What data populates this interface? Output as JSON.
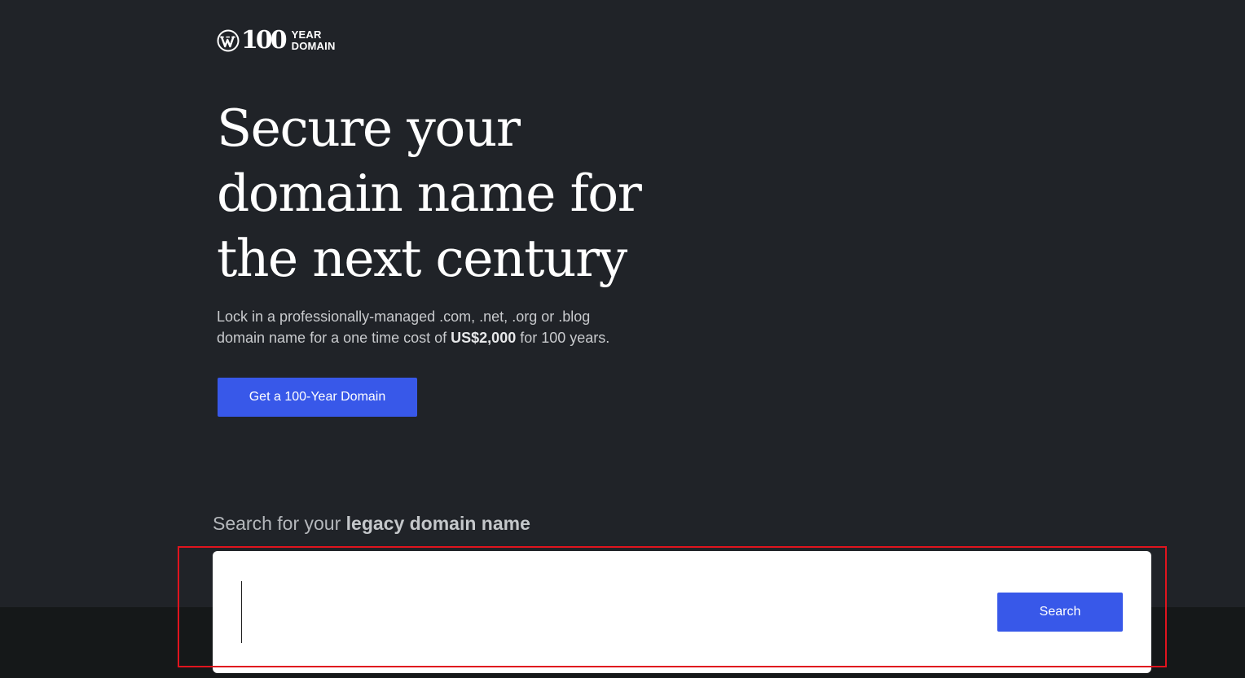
{
  "logo": {
    "number": "100",
    "line1": "YEAR",
    "line2": "DOMAIN",
    "icon": "wordpress-logo-icon"
  },
  "hero": {
    "headline_lines": [
      "Secure your",
      "domain name for",
      "the next century"
    ],
    "subtitle_line1": "Lock in a professionally-managed .com, .net, .org or .blog",
    "subtitle_line2_prefix": "domain name for a one time cost of ",
    "subtitle_price": "US$2,000",
    "subtitle_line2_suffix": " for 100 years.",
    "cta_label": "Get a 100-Year Domain"
  },
  "search": {
    "heading_prefix": "Search for your ",
    "heading_bold": "legacy domain name",
    "input_value": "",
    "input_placeholder": "",
    "button_label": "Search"
  },
  "colors": {
    "background": "#202328",
    "bottom_band": "#151819",
    "accent": "#3858e9",
    "highlight_outline": "#e0141e"
  }
}
